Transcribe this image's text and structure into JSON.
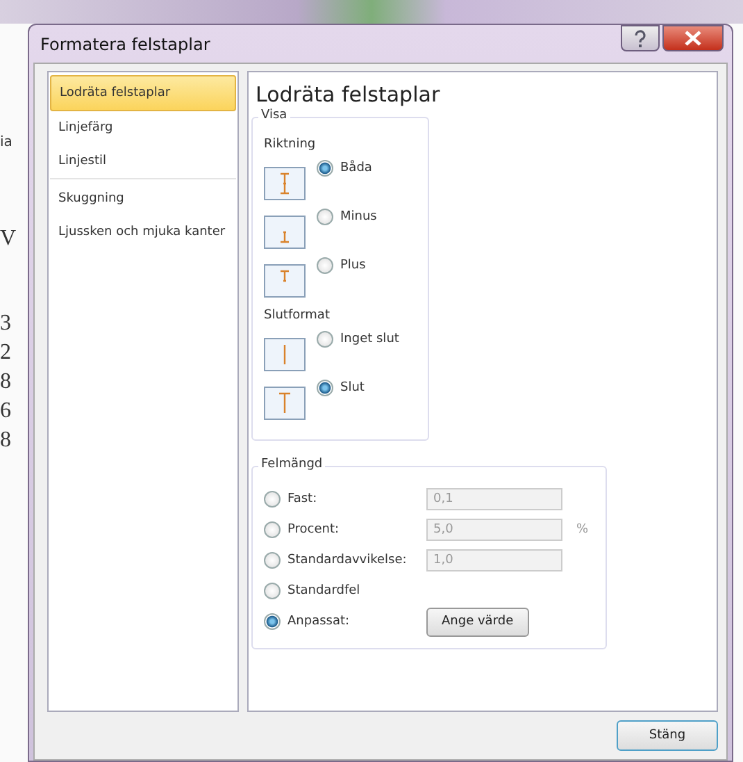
{
  "background": {
    "left_fragments": [
      "ia",
      "V",
      "3",
      "2",
      "8",
      "6",
      "8"
    ]
  },
  "dialog": {
    "title": "Formatera felstaplar"
  },
  "sidebar": {
    "groups": [
      [
        {
          "label": "Lodräta felstaplar",
          "selected": true
        },
        {
          "label": "Linjefärg",
          "selected": false
        },
        {
          "label": "Linjestil",
          "selected": false
        }
      ],
      [
        {
          "label": "Skuggning",
          "selected": false
        },
        {
          "label": "Ljussken och mjuka kanter",
          "selected": false
        }
      ]
    ]
  },
  "panel": {
    "heading": "Lodräta felstaplar",
    "visa": {
      "legend": "Visa",
      "sections": [
        {
          "label": "Riktning",
          "options": [
            {
              "label": "Båda",
              "selected": true,
              "kind": "both"
            },
            {
              "label": "Minus",
              "selected": false,
              "kind": "minus"
            },
            {
              "label": "Plus",
              "selected": false,
              "kind": "plus"
            }
          ]
        },
        {
          "label": "Slutformat",
          "options": [
            {
              "label": "Inget slut",
              "selected": false,
              "kind": "nocap"
            },
            {
              "label": "Slut",
              "selected": true,
              "kind": "cap"
            }
          ]
        }
      ]
    },
    "felmangd": {
      "legend": "Felmängd",
      "options": [
        {
          "label": "Fast:",
          "selected": false,
          "field": {
            "value": "0,1",
            "disabled": true
          }
        },
        {
          "label": "Procent:",
          "selected": false,
          "field": {
            "value": "5,0",
            "disabled": true
          },
          "unit": "%"
        },
        {
          "label": "Standardavvikelse:",
          "selected": false,
          "field": {
            "value": "1,0",
            "disabled": true
          }
        },
        {
          "label": "Standardfel",
          "selected": false
        },
        {
          "label": "Anpassat:",
          "selected": true,
          "button": "Ange värde"
        }
      ]
    }
  },
  "footer": {
    "button": "Stäng"
  }
}
